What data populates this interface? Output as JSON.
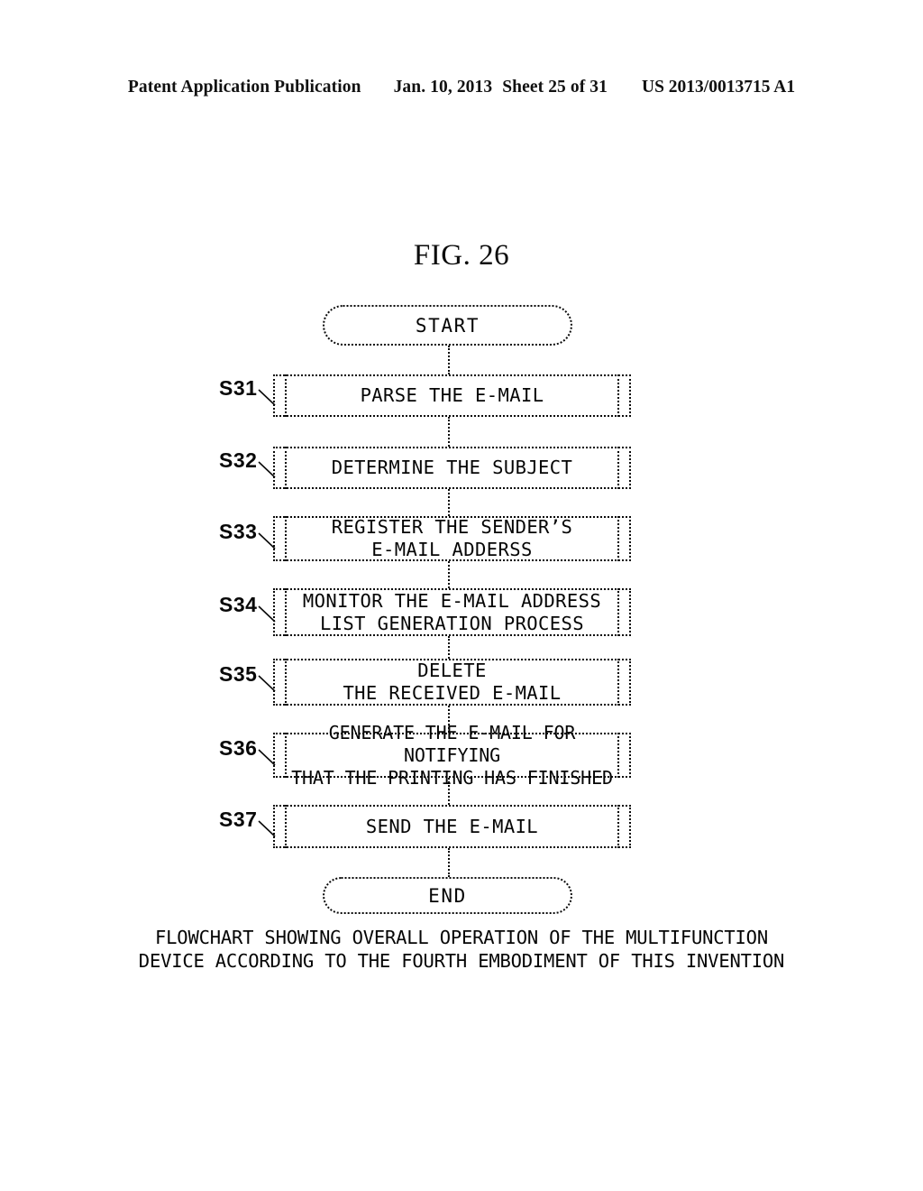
{
  "header": {
    "publication": "Patent Application Publication",
    "date": "Jan. 10, 2013",
    "sheet": "Sheet 25 of 31",
    "patent_number": "US 2013/0013715 A1"
  },
  "figure": {
    "title": "FIG. 26",
    "caption": "FLOWCHART SHOWING OVERALL OPERATION OF THE MULTIFUNCTION\nDEVICE ACCORDING TO THE FOURTH EMBODIMENT OF THIS INVENTION"
  },
  "flowchart": {
    "type": "flowchart",
    "orientation": "top-to-bottom",
    "start_label": "START",
    "end_label": "END",
    "steps": [
      {
        "id": "S31",
        "text": "PARSE THE E-MAIL"
      },
      {
        "id": "S32",
        "text": "DETERMINE THE SUBJECT"
      },
      {
        "id": "S33",
        "text": "REGISTER THE SENDER’S\nE-MAIL ADDERSS"
      },
      {
        "id": "S34",
        "text": "MONITOR THE E-MAIL ADDRESS\nLIST GENERATION PROCESS"
      },
      {
        "id": "S35",
        "text": "DELETE\nTHE RECEIVED E-MAIL"
      },
      {
        "id": "S36",
        "text": "GENERATE THE E-MAIL FOR NOTIFYING\nTHAT THE PRINTING HAS FINISHED"
      },
      {
        "id": "S37",
        "text": "SEND THE E-MAIL"
      }
    ]
  },
  "colors": {
    "ink": "#050505",
    "paper": "#ffffff"
  }
}
